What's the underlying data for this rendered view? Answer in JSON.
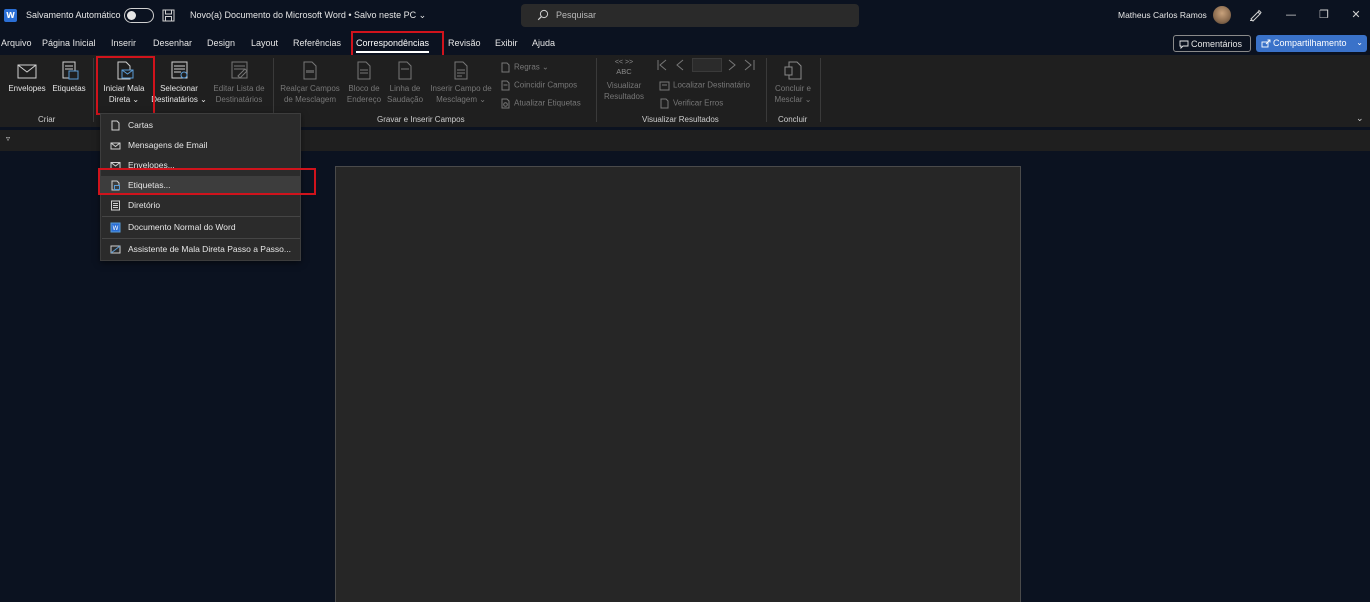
{
  "titlebar": {
    "app_logo": "W",
    "autosave_label": "Salvamento Automático",
    "doc_title": "Novo(a) Documento do Microsoft Word • Salvo neste PC ⌄",
    "search_placeholder": "Pesquisar",
    "user_name": "Matheus Carlos Ramos",
    "window_controls": [
      "minimize-icon",
      "restore-icon",
      "close-icon"
    ],
    "min_glyph": "—",
    "restore_glyph": "❐",
    "close_glyph": "✕"
  },
  "tabs": [
    {
      "label": "Arquivo"
    },
    {
      "label": "Página Inicial"
    },
    {
      "label": "Inserir"
    },
    {
      "label": "Desenhar"
    },
    {
      "label": "Design"
    },
    {
      "label": "Layout"
    },
    {
      "label": "Referências"
    },
    {
      "label": "Correspondências",
      "active": true
    },
    {
      "label": "Revisão"
    },
    {
      "label": "Exibir"
    },
    {
      "label": "Ajuda"
    }
  ],
  "header_actions": {
    "comments_label": "Comentários",
    "share_label": "Compartilhamento",
    "share_caret": "⌄"
  },
  "ribbon": {
    "envelopes_label": "Envelopes",
    "etiquetas_label": "Etiquetas",
    "iniciar_line1": "Iniciar Mala",
    "iniciar_line2": "Direta ⌄",
    "selecionar_line1": "Selecionar",
    "selecionar_line2": "Destinatários ⌄",
    "editar_line1": "Editar Lista de",
    "editar_line2": "Destinatários",
    "realcar_line1": "Realçar Campos",
    "realcar_line2": "de Mesclagem",
    "bloco_line1": "Bloco de",
    "bloco_line2": "Endereço",
    "linha_line1": "Linha de",
    "linha_line2": "Saudação",
    "inserir_line1": "Inserir Campo de",
    "inserir_line2": "Mesclagem ⌄",
    "regras_label": "Regras ⌄",
    "coincidir_label": "Coincidir Campos",
    "atualizar_label": "Atualizar Etiquetas",
    "abc_label": "ABC",
    "visualizar_line1": "Visualizar",
    "visualizar_line2": "Resultados",
    "localizar_label": "Localizar Destinatário",
    "verificar_label": "Verificar Erros",
    "concluir_line1": "Concluir e",
    "concluir_line2": "Mesclar ⌄",
    "groups": {
      "criar": "Criar",
      "gravar": "Gravar e Inserir Campos",
      "visualizar": "Visualizar Resultados",
      "concluir": "Concluir"
    },
    "expand_glyph": "⌄"
  },
  "qab_glyph": "▿",
  "dropdown": {
    "items": [
      {
        "label": "Cartas",
        "icon": "letter-icon"
      },
      {
        "label": "Mensagens de Email",
        "icon": "email-icon"
      },
      {
        "label": "Envelopes...",
        "icon": "envelope-icon"
      },
      {
        "label": "Etiquetas...",
        "icon": "label-icon",
        "highlighted": true
      },
      {
        "label": "Diretório",
        "icon": "directory-icon"
      },
      {
        "label": "Documento Normal do Word",
        "icon": "word-doc-icon"
      },
      {
        "label": "Assistente de Mala Direta Passo a Passo...",
        "icon": "wizard-icon"
      }
    ]
  },
  "colors": {
    "accent_red": "#d0131c",
    "share_blue": "#3a72c9",
    "ribbon_bg": "#1f1f1f",
    "app_bg": "#0b1220"
  }
}
